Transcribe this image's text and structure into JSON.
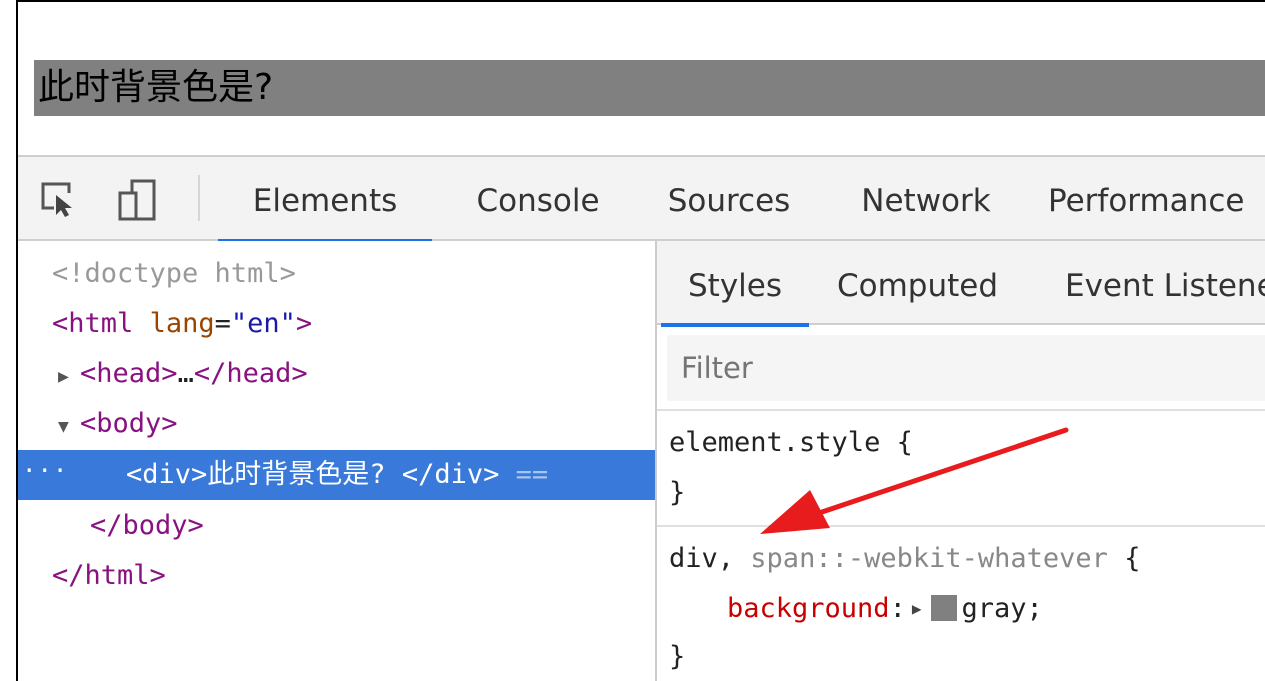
{
  "page": {
    "div_text": "此时背景色是?",
    "div_background": "#808080"
  },
  "toolbar": {
    "tabs": [
      {
        "label": "Elements",
        "active": true
      },
      {
        "label": "Console",
        "active": false
      },
      {
        "label": "Sources",
        "active": false
      },
      {
        "label": "Network",
        "active": false
      },
      {
        "label": "Performance",
        "active": false
      }
    ],
    "icons": [
      "inspect-element-icon",
      "device-toolbar-icon"
    ],
    "accent": "#1a73e8"
  },
  "dom_tree": {
    "doctype": "<!doctype html>",
    "html_open_tag": "html",
    "html_attr_name": "lang",
    "html_attr_value": "\"en\"",
    "head_tag": "head",
    "head_ellipsis": "…",
    "body_tag": "body",
    "selected": {
      "dots": "...",
      "open_tag": "<div>",
      "text": "此时背景色是?",
      "close_tag": "</div>",
      "eq": "=="
    },
    "body_close": "body",
    "html_close": "html",
    "selection_color": "#3879d9"
  },
  "styles_panel": {
    "tabs": [
      {
        "label": "Styles",
        "active": true
      },
      {
        "label": "Computed",
        "active": false
      },
      {
        "label": "Event Listene",
        "active": false
      }
    ],
    "filter_placeholder": "Filter",
    "rules": [
      {
        "selector": "element.style",
        "open": "{",
        "close": "}"
      },
      {
        "selector_main": "div,",
        "selector_dim": "span::-webkit-whatever",
        "open": "{",
        "property": "background",
        "colon": ":",
        "value": "gray;",
        "close": "}"
      }
    ]
  },
  "annotation": {
    "arrow_color": "#e81c1c"
  }
}
